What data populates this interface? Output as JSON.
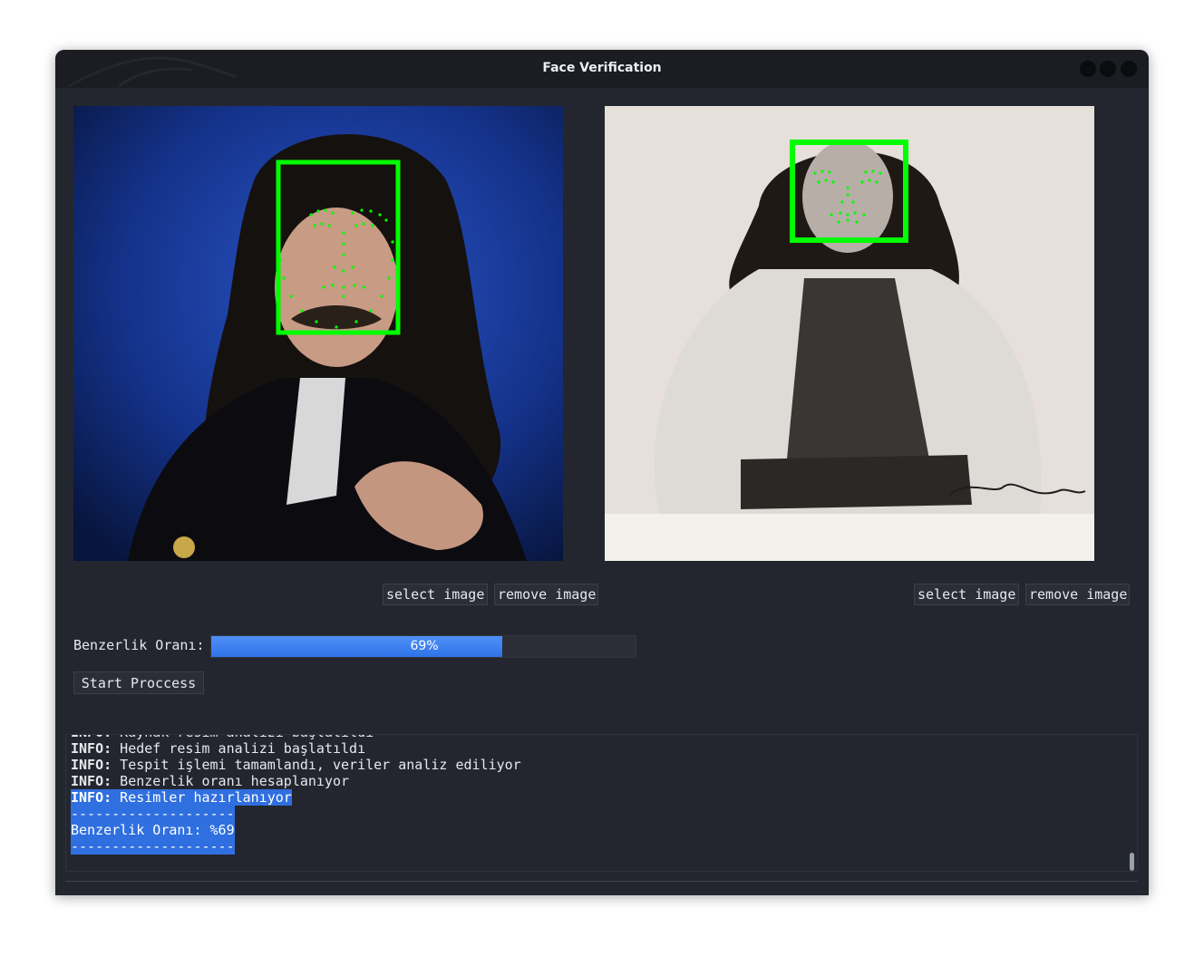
{
  "window": {
    "title": "Face Verification"
  },
  "images": [
    {
      "name": "source-face-image",
      "face_landmarks": "green-landmarks"
    },
    {
      "name": "target-face-image",
      "face_landmarks": "green-landmarks"
    }
  ],
  "left_controls": {
    "select_label": "select image",
    "remove_label": "remove image"
  },
  "right_controls": {
    "select_label": "select image",
    "remove_label": "remove image"
  },
  "similarity": {
    "label": "Benzerlik Oranı:",
    "percent": 69,
    "text": "69%"
  },
  "start_button": {
    "label": "Start Proccess"
  },
  "log": {
    "lines": [
      {
        "prefix": "INFO:",
        "text": " Kaynak resim analizi başlatıldı",
        "selected": false
      },
      {
        "prefix": "INFO:",
        "text": " Hedef resim analizi başlatıldı",
        "selected": false
      },
      {
        "prefix": "INFO:",
        "text": " Tespit işlemi tamamlandı, veriler analiz ediliyor",
        "selected": false
      },
      {
        "prefix": "INFO:",
        "text": " Benzerlik oranı hesaplanıyor",
        "selected": false
      },
      {
        "prefix": "INFO:",
        "text": " Resimler hazırlanıyor",
        "selected": true
      },
      {
        "prefix": "",
        "text": "--------------------",
        "selected": true
      },
      {
        "prefix": "",
        "text": "Benzerlik Oranı: %69",
        "selected": true
      },
      {
        "prefix": "",
        "text": "--------------------",
        "selected": true
      }
    ]
  },
  "colors": {
    "window_bg": "#23262e",
    "titlebar_bg": "#1b1d23",
    "accent": "#2f73e8",
    "landmark_green": "#00ff00"
  }
}
